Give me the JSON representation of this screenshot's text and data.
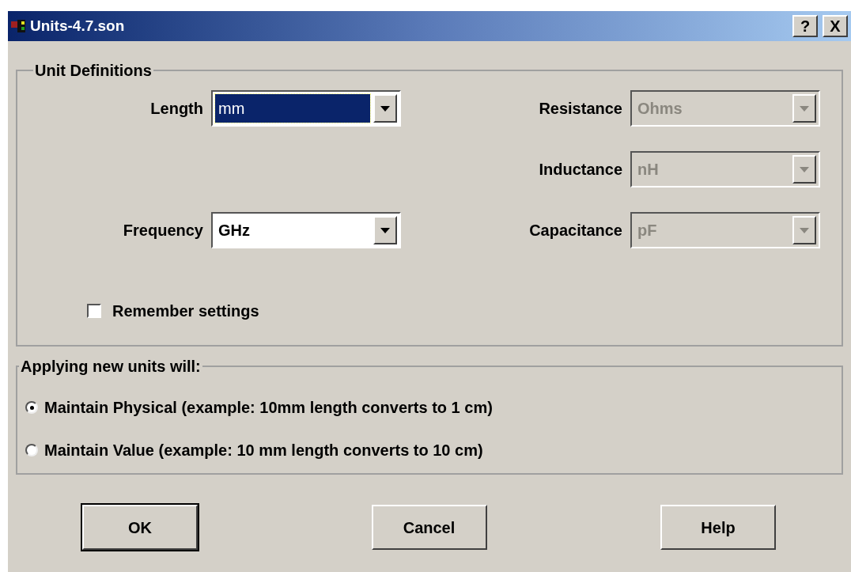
{
  "window": {
    "title": "Units-4.7.son",
    "buttons": [
      {
        "kind": "help",
        "label": "?"
      },
      {
        "kind": "close",
        "label": "X"
      }
    ]
  },
  "unit_definitions": {
    "title": "Unit Definitions",
    "left_fields": [
      {
        "label": "Length",
        "value": "mm",
        "disabled": false,
        "focused": true
      },
      {
        "label": "Frequency",
        "value": "GHz",
        "disabled": false,
        "focused": false
      }
    ],
    "right_fields": [
      {
        "label": "Resistance",
        "value": "Ohms",
        "disabled": true,
        "focused": false
      },
      {
        "label": "Inductance",
        "value": "nH",
        "disabled": true,
        "focused": false
      },
      {
        "label": "Capacitance",
        "value": "pF",
        "disabled": true,
        "focused": false
      }
    ],
    "remember": {
      "label": "Remember settings",
      "checked": false
    }
  },
  "applying": {
    "title": "Applying new units will:",
    "options": [
      {
        "label": "Maintain Physical (example: 10mm length converts to 1 cm)",
        "selected": true
      },
      {
        "label": "Maintain Value (example: 10 mm length converts to 10 cm)",
        "selected": false
      }
    ]
  },
  "buttons": [
    "OK",
    "Cancel",
    "Help"
  ]
}
